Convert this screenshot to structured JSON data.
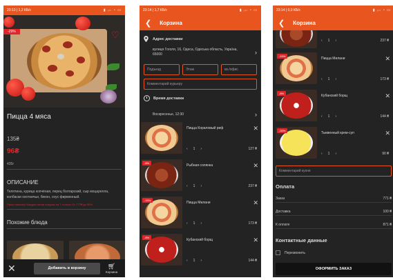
{
  "phone1": {
    "status": "23:13 | 1,2 КБ/с",
    "status_icons": "▮ ᵢₗₗ ◔ ▭",
    "discount": "-29%",
    "title": "Пицца 4 мяса",
    "old_price": "135₴",
    "new_price": "96₴",
    "weight": "435г",
    "description_header": "ОПИСАНИЕ",
    "description": "Телятина, курица копчёная, перец болгарский, сыр моцарелла, колбаски охотничьи, бекон, соус фирменный.",
    "promo": "Пиши нашему! Каждая пятая покупка на 7 только! От 777₴ до 50%",
    "similar_header": "Похожие блюда",
    "add_to_cart": "Добавить в корзину",
    "cart_label": "Корзина"
  },
  "phone2": {
    "status": "23:14 | 1,7 КБ/с",
    "status_icons": "▮ ᵢₗₗ ◔ ▭",
    "title": "Корзина",
    "address_header": "Адрес доставки",
    "address": "вулиця Гоголя, 16, Одеса, Одеська область, Україна, 65000",
    "field_entrance": "Подъезд",
    "field_floor": "Этаж",
    "field_apt": "кв./офис",
    "field_comment": "Комментарий курьеру",
    "time_header": "Время доставки",
    "time_value": "Воскресенье, 12:30",
    "items": [
      {
        "name": "Пицца Кораловый риф",
        "qty": "1",
        "price": "127 ₴",
        "badge": ""
      },
      {
        "name": "Рыбная солянка",
        "qty": "1",
        "price": "237 ₴",
        "badge": "-8%"
      },
      {
        "name": "Пицца Милани",
        "qty": "1",
        "price": "173 ₴",
        "badge": "-15%"
      },
      {
        "name": "Кубанский борщ",
        "qty": "1",
        "price": "144 ₴",
        "badge": "-8%"
      }
    ]
  },
  "phone3": {
    "status": "23:14 | 0,0 КБ/с",
    "status_icons": "▮ ᵢₗₗ ◔ ▭",
    "title": "Корзина",
    "items": [
      {
        "name": "",
        "qty": "1",
        "price": "237 ₴",
        "badge": ""
      },
      {
        "name": "Пицца Милани",
        "qty": "1",
        "price": "173 ₴",
        "badge": "-15%"
      },
      {
        "name": "Кубанский борщ",
        "qty": "1",
        "price": "144 ₴",
        "badge": "-8%"
      },
      {
        "name": "Тыквенный крем-суп",
        "qty": "1",
        "price": "90 ₴",
        "badge": "-33%"
      }
    ],
    "comment_kitchen": "Комментарий кухне",
    "payment_header": "Оплата",
    "order_label": "Заказ",
    "order_value": "771 ₴",
    "delivery_label": "Доставка",
    "delivery_value": "100 ₴",
    "total_label": "К оплате",
    "total_value": "871 ₴",
    "contact_header": "Контактные данные",
    "callback_label": "Перезвонить",
    "submit": "ОФОРМИТЬ ЗАКАЗ"
  },
  "colors": {
    "accent": "#e8551f",
    "sale": "#e0262b",
    "bg": "#232323"
  }
}
